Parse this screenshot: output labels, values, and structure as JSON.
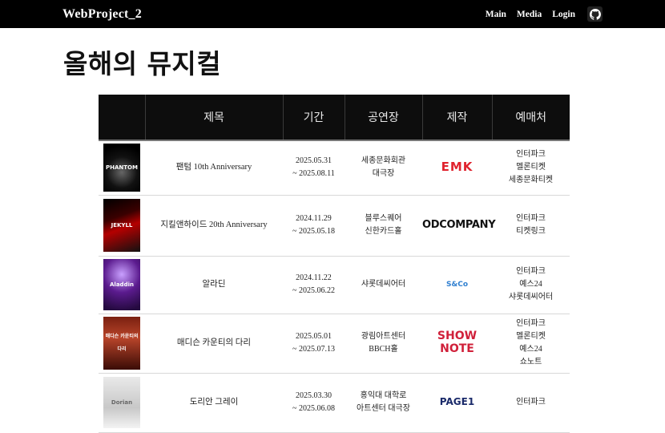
{
  "nav": {
    "brand": "WebProject_2",
    "links": [
      "Main",
      "Media",
      "Login"
    ],
    "github_icon": "github-icon"
  },
  "page": {
    "title": "올해의 뮤지컬"
  },
  "table": {
    "headers": [
      "",
      "제목",
      "기간",
      "공연장",
      "제작",
      "예매처"
    ],
    "rows": [
      {
        "poster_text": "PHANTOM",
        "title": "팬텀 10th Anniversary",
        "period_start": "2025.05.31",
        "period_end": "~ 2025.08.11",
        "venue": [
          "세종문화회관",
          "대극장"
        ],
        "producer": "EMK",
        "tickets": [
          "인터파크",
          "멜론티켓",
          "세종문화티켓"
        ]
      },
      {
        "poster_text": "JEKYLL",
        "title": "지킬앤하이드 20th Anniversary",
        "period_start": "2024.11.29",
        "period_end": "~ 2025.05.18",
        "venue": [
          "블루스퀘어",
          "신한카드홀"
        ],
        "producer": "ODCOMPANY",
        "tickets": [
          "인터파크",
          "티켓링크"
        ]
      },
      {
        "poster_text": "Aladdin",
        "title": "알라딘",
        "period_start": "2024.11.22",
        "period_end": "~ 2025.06.22",
        "venue": [
          "샤롯데씨어터"
        ],
        "producer": "S&Co",
        "tickets": [
          "인터파크",
          "예스24",
          "샤롯데씨어터"
        ]
      },
      {
        "poster_text": "매디슨 카운티의 다리",
        "title": "매디슨 카운티의 다리",
        "period_start": "2025.05.01",
        "period_end": "~ 2025.07.13",
        "venue": [
          "광림아트센터",
          "BBCH홀"
        ],
        "producer": "SHOW NOTE",
        "tickets": [
          "인터파크",
          "멜론티켓",
          "예스24",
          "쇼노트"
        ]
      },
      {
        "poster_text": "Dorian",
        "title": "도리안 그레이",
        "period_start": "2025.03.30",
        "period_end": "~ 2025.06.08",
        "venue": [
          "홍익대 대학로",
          "아트센터 대극장"
        ],
        "producer": "PAGE1",
        "tickets": [
          "인터파크"
        ]
      }
    ]
  },
  "colors": {
    "navbar_bg": "#000000",
    "table_header_bg": "#0d0d0d",
    "emk_red": "#e0232e",
    "saco_blue": "#2f7fd0",
    "shownote_red": "#d0203a",
    "page1_navy": "#1a2a6a"
  }
}
